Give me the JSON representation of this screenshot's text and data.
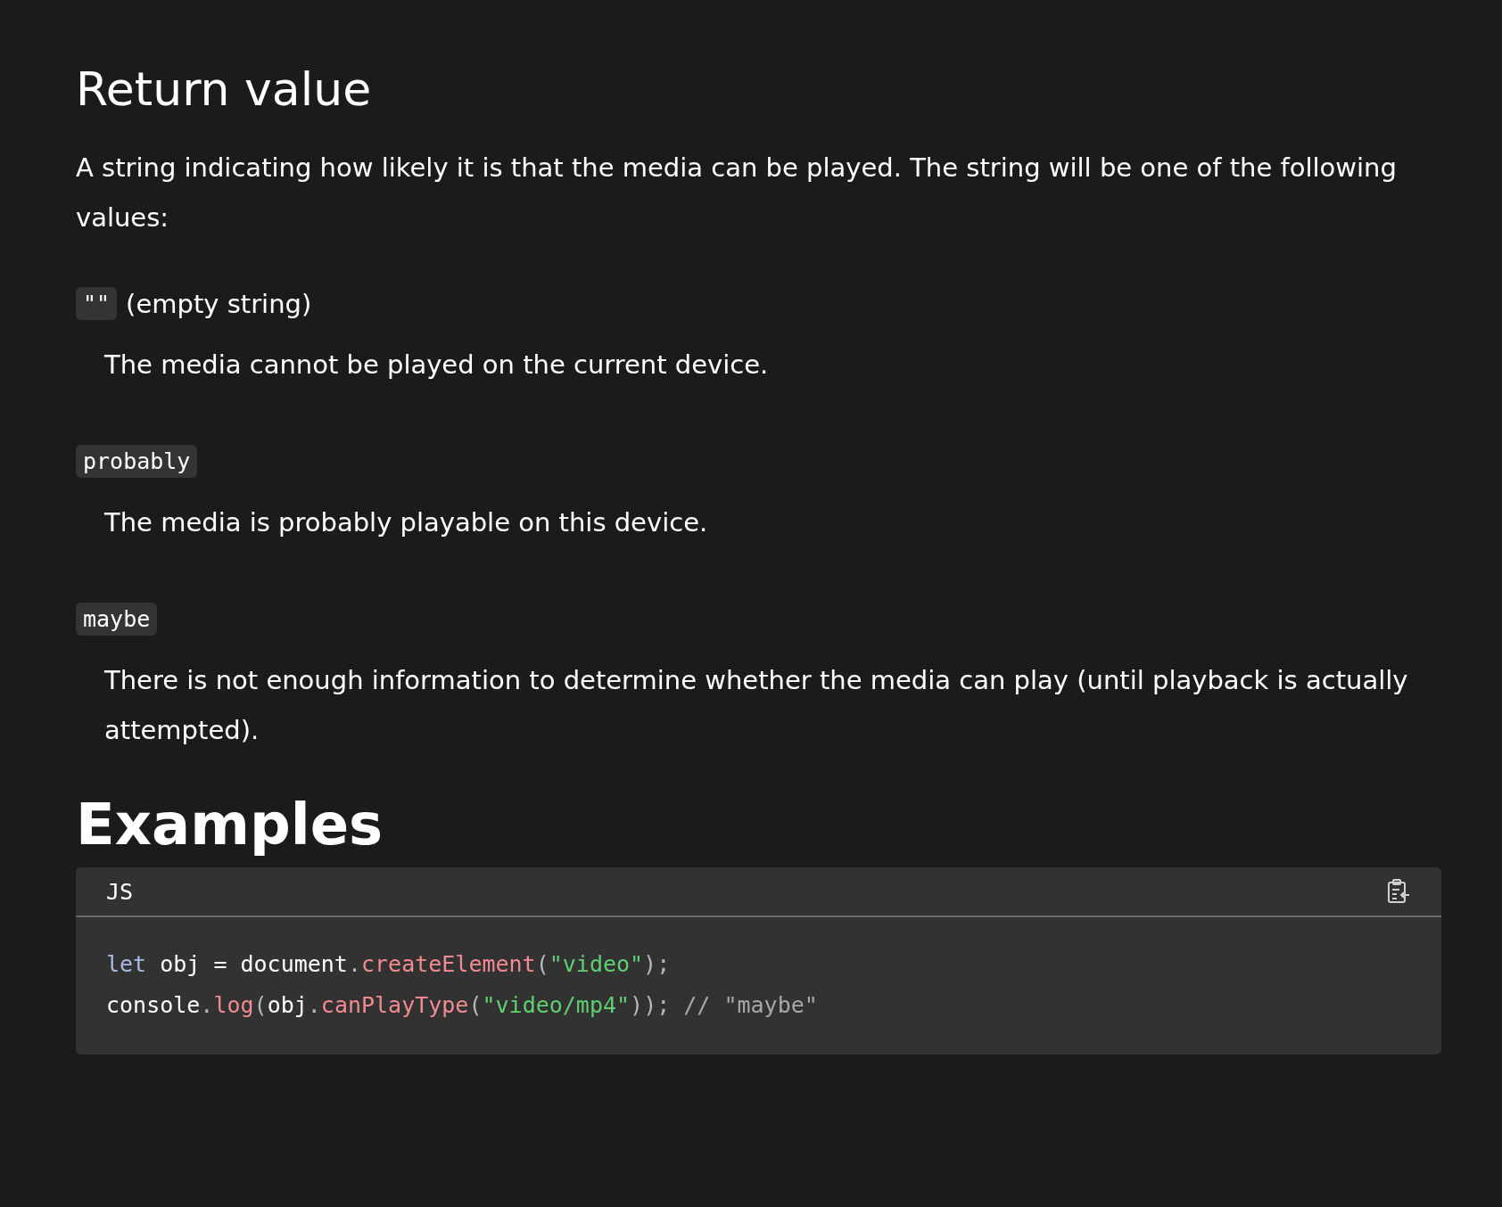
{
  "section_heading": "Return value",
  "intro": "A string indicating how likely it is that the media can be played. The string will be one of the following values:",
  "values": [
    {
      "term": "\"\"",
      "term_note": "(empty string)",
      "description": "The media cannot be played on the current device."
    },
    {
      "term": "probably",
      "description": "The media is probably playable on this device."
    },
    {
      "term": "maybe",
      "description": "There is not enough information to determine whether the media can play (until playback is actually attempted)."
    }
  ],
  "examples_heading": "Examples",
  "code_block": {
    "language": "JS",
    "lines": [
      [
        {
          "kind": "keyword",
          "text": "let"
        },
        {
          "kind": "plain",
          "text": " obj = document"
        },
        {
          "kind": "punct",
          "text": "."
        },
        {
          "kind": "func",
          "text": "createElement"
        },
        {
          "kind": "punct",
          "text": "("
        },
        {
          "kind": "string",
          "text": "\"video\""
        },
        {
          "kind": "punct",
          "text": ");"
        }
      ],
      [
        {
          "kind": "plain",
          "text": "console"
        },
        {
          "kind": "punct",
          "text": "."
        },
        {
          "kind": "func",
          "text": "log"
        },
        {
          "kind": "punct",
          "text": "("
        },
        {
          "kind": "plain",
          "text": "obj"
        },
        {
          "kind": "punct",
          "text": "."
        },
        {
          "kind": "func",
          "text": "canPlayType"
        },
        {
          "kind": "punct",
          "text": "("
        },
        {
          "kind": "string",
          "text": "\"video/mp4\""
        },
        {
          "kind": "punct",
          "text": "));"
        },
        {
          "kind": "comment",
          "text": " // \"maybe\""
        }
      ]
    ]
  }
}
